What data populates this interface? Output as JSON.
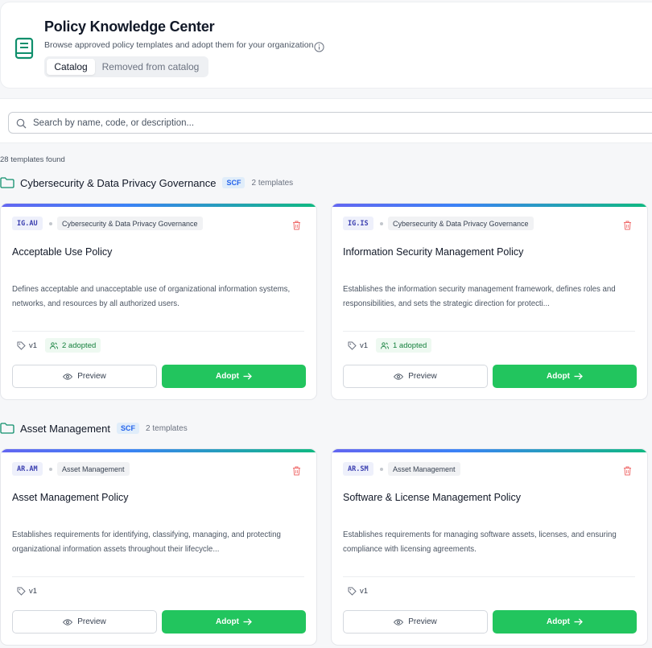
{
  "header": {
    "title": "Policy Knowledge Center",
    "subtitle": "Browse approved policy templates and adopt them for your organization",
    "tabs": [
      {
        "label": "Catalog",
        "active": true
      },
      {
        "label": "Removed from catalog",
        "active": false
      }
    ]
  },
  "search": {
    "placeholder": "Search by name, code, or description...",
    "value": ""
  },
  "results": {
    "count_text": "28 templates found"
  },
  "colors": {
    "accent_green": "#22c55e",
    "brand_teal": "#0f8f6c",
    "scf_blue": "#2563eb",
    "trash_red": "#ef6b6b"
  },
  "sections": [
    {
      "title": "Cybersecurity & Data Privacy Governance",
      "badge": "SCF",
      "count": "2 templates",
      "cards": [
        {
          "code": "IG.AU",
          "category": "Cybersecurity & Data Privacy Governance",
          "title": "Acceptable Use Policy",
          "description": "Defines acceptable and unacceptable use of organizational information systems, networks, and resources by all authorized users.",
          "version": "v1",
          "adopted": "2 adopted",
          "preview_label": "Preview",
          "adopt_label": "Adopt"
        },
        {
          "code": "IG.IS",
          "category": "Cybersecurity & Data Privacy Governance",
          "title": "Information Security Management Policy",
          "description": "Establishes the information security management framework, defines roles and responsibilities, and sets the strategic direction for protecti...",
          "version": "v1",
          "adopted": "1 adopted",
          "preview_label": "Preview",
          "adopt_label": "Adopt"
        }
      ]
    },
    {
      "title": "Asset Management",
      "badge": "SCF",
      "count": "2 templates",
      "cards": [
        {
          "code": "AR.AM",
          "category": "Asset Management",
          "title": "Asset Management Policy",
          "description": "Establishes requirements for identifying, classifying, managing, and protecting organizational information assets throughout their lifecycle...",
          "version": "v1",
          "adopted": "",
          "preview_label": "Preview",
          "adopt_label": "Adopt"
        },
        {
          "code": "AR.SM",
          "category": "Asset Management",
          "title": "Software & License Management Policy",
          "description": "Establishes requirements for managing software assets, licenses, and ensuring compliance with licensing agreements.",
          "version": "v1",
          "adopted": "",
          "preview_label": "Preview",
          "adopt_label": "Adopt"
        }
      ]
    }
  ]
}
